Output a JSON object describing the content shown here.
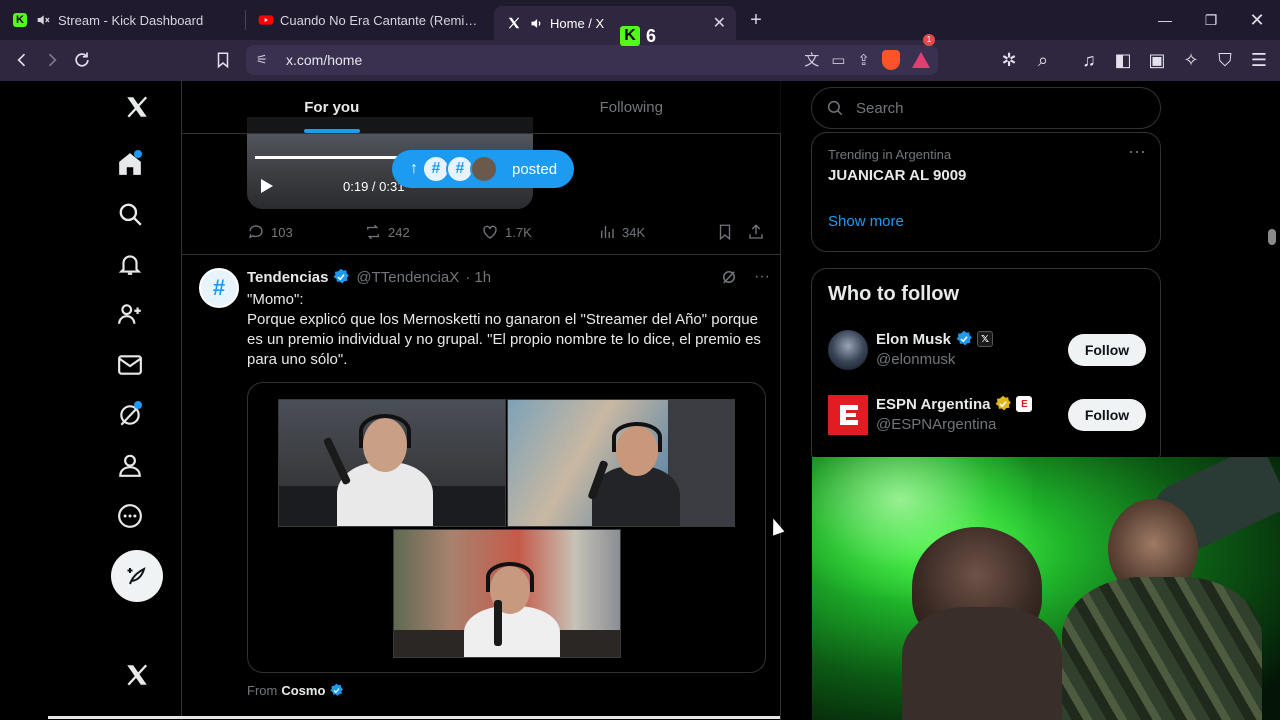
{
  "browser": {
    "tabs": [
      {
        "title": "Stream - Kick Dashboard",
        "icon": "kick-icon"
      },
      {
        "title": "Cuando No Era Cantante (Remix) - Yo",
        "icon": "youtube-icon"
      },
      {
        "title": "Home / X",
        "icon": "x-icon"
      }
    ],
    "kick_badge": "6",
    "url": "x.com/home",
    "brave_badge": "1"
  },
  "timeline": {
    "tabs": [
      {
        "label": "For you"
      },
      {
        "label": "Following"
      }
    ],
    "video": {
      "time": "0:19 / 0:31",
      "progress": 0.55
    },
    "posted_pill": {
      "label": "posted"
    },
    "prev_stats": {
      "replies": "103",
      "reposts": "242",
      "likes": "1.7K",
      "views": "34K"
    },
    "tweet": {
      "name": "Tendencias",
      "handle": "@TTendenciaX",
      "time": "· 1h",
      "line1": "\"Momo\":",
      "body": "Porque explicó que los Mernosketti no ganaron el \"Streamer del Año\" porque es un premio individual y no grupal. \"El propio nombre te lo dice, el premio es para uno sólo\".",
      "from_prefix": "From",
      "from_name": "Cosmo"
    }
  },
  "sidebar": {
    "search_placeholder": "Search",
    "trend": {
      "meta": "Trending in Argentina",
      "name": "JUANICAR AL 9009",
      "show_more": "Show more"
    },
    "who_to_follow": {
      "title": "Who to follow",
      "accounts": [
        {
          "name": "Elon Musk",
          "handle": "@elonmusk",
          "button": "Follow"
        },
        {
          "name": "ESPN Argentina",
          "handle": "@ESPNArgentina",
          "button": "Follow",
          "logo_letter": "E"
        }
      ]
    }
  },
  "colors": {
    "accent": "#1d9bf0",
    "kick_green": "#53fc18",
    "espn_red": "#e31b23"
  }
}
